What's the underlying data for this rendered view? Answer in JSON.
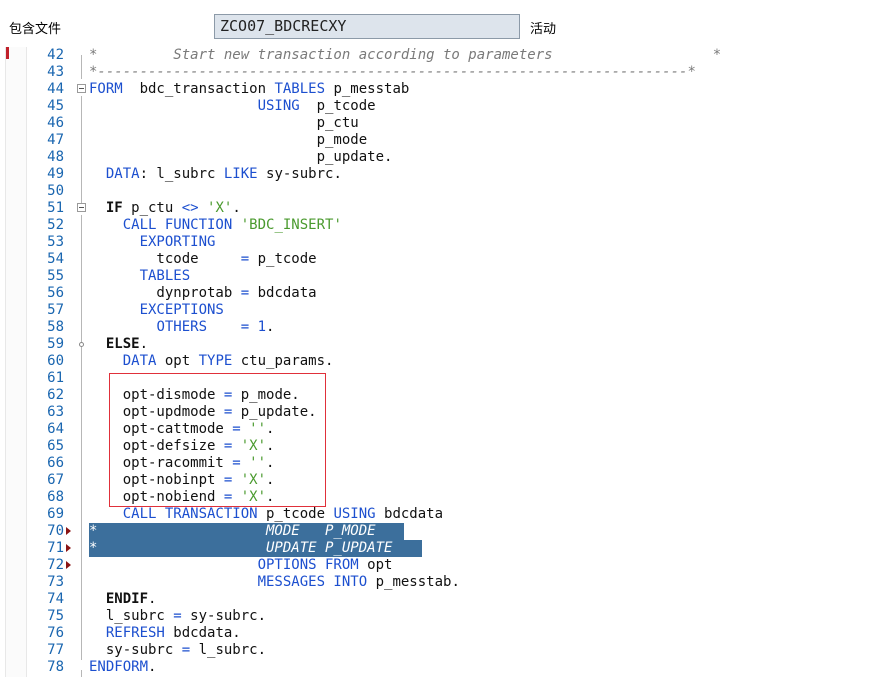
{
  "header": {
    "include_label": "包含文件",
    "program_name": "ZCO07_BDCRECXY",
    "status": "活动"
  },
  "editor": {
    "lines": [
      {
        "n": "42",
        "t": [
          [
            "cmt",
            "*         Start new transaction according to parameters                   *"
          ]
        ]
      },
      {
        "n": "43",
        "t": [
          [
            "cmt",
            "*----------------------------------------------------------------------*"
          ]
        ]
      },
      {
        "n": "44",
        "t": [
          [
            "kw",
            "FORM"
          ],
          [
            "",
            "  bdc_transaction "
          ],
          [
            "kw",
            "TABLES"
          ],
          [
            "",
            " p_messtab"
          ]
        ]
      },
      {
        "n": "45",
        "t": [
          [
            "",
            "                    "
          ],
          [
            "kw",
            "USING"
          ],
          [
            "",
            "  p_tcode"
          ]
        ]
      },
      {
        "n": "46",
        "t": [
          [
            "",
            "                           p_ctu"
          ]
        ]
      },
      {
        "n": "47",
        "t": [
          [
            "",
            "                           p_mode"
          ]
        ]
      },
      {
        "n": "48",
        "t": [
          [
            "",
            "                           p_update."
          ]
        ]
      },
      {
        "n": "49",
        "t": [
          [
            "",
            "  "
          ],
          [
            "kw",
            "DATA"
          ],
          [
            "",
            ": l_subrc "
          ],
          [
            "kw",
            "LIKE"
          ],
          [
            "",
            " sy-subrc."
          ]
        ]
      },
      {
        "n": "50",
        "t": []
      },
      {
        "n": "51",
        "t": [
          [
            "",
            "  "
          ],
          [
            "b",
            "IF"
          ],
          [
            "",
            " p_ctu "
          ],
          [
            "kw",
            "<>"
          ],
          [
            "",
            " "
          ],
          [
            "str",
            "'X'"
          ],
          [
            "",
            "."
          ]
        ]
      },
      {
        "n": "52",
        "t": [
          [
            "",
            "    "
          ],
          [
            "kw",
            "CALL FUNCTION"
          ],
          [
            "",
            " "
          ],
          [
            "str",
            "'BDC_INSERT'"
          ]
        ]
      },
      {
        "n": "53",
        "t": [
          [
            "",
            "      "
          ],
          [
            "kw",
            "EXPORTING"
          ]
        ]
      },
      {
        "n": "54",
        "t": [
          [
            "",
            "        tcode     "
          ],
          [
            "kw",
            "="
          ],
          [
            "",
            " p_tcode"
          ]
        ]
      },
      {
        "n": "55",
        "t": [
          [
            "",
            "      "
          ],
          [
            "kw",
            "TABLES"
          ]
        ]
      },
      {
        "n": "56",
        "t": [
          [
            "",
            "        dynprotab "
          ],
          [
            "kw",
            "="
          ],
          [
            "",
            " bdcdata"
          ]
        ]
      },
      {
        "n": "57",
        "t": [
          [
            "",
            "      "
          ],
          [
            "kw",
            "EXCEPTIONS"
          ]
        ]
      },
      {
        "n": "58",
        "t": [
          [
            "",
            "        "
          ],
          [
            "kw",
            "OTHERS"
          ],
          [
            "",
            "    "
          ],
          [
            "kw",
            "="
          ],
          [
            "",
            " "
          ],
          [
            "num",
            "1"
          ],
          [
            "",
            "."
          ]
        ]
      },
      {
        "n": "59",
        "t": [
          [
            "",
            "  "
          ],
          [
            "b",
            "ELSE"
          ],
          [
            "",
            "."
          ]
        ]
      },
      {
        "n": "60",
        "t": [
          [
            "",
            "    "
          ],
          [
            "kw",
            "DATA"
          ],
          [
            "",
            " opt "
          ],
          [
            "kw",
            "TYPE"
          ],
          [
            "",
            " ctu_params."
          ]
        ]
      },
      {
        "n": "61",
        "t": []
      },
      {
        "n": "62",
        "t": [
          [
            "",
            "    opt-dismode "
          ],
          [
            "kw",
            "="
          ],
          [
            "",
            " p_mode."
          ]
        ]
      },
      {
        "n": "63",
        "t": [
          [
            "",
            "    opt-updmode "
          ],
          [
            "kw",
            "="
          ],
          [
            "",
            " p_update."
          ]
        ]
      },
      {
        "n": "64",
        "t": [
          [
            "",
            "    opt-cattmode "
          ],
          [
            "kw",
            "="
          ],
          [
            "",
            " "
          ],
          [
            "str",
            "''"
          ],
          [
            "",
            "."
          ]
        ]
      },
      {
        "n": "65",
        "t": [
          [
            "",
            "    opt-defsize "
          ],
          [
            "kw",
            "="
          ],
          [
            "",
            " "
          ],
          [
            "str",
            "'X'"
          ],
          [
            "",
            "."
          ]
        ]
      },
      {
        "n": "66",
        "t": [
          [
            "",
            "    opt-racommit "
          ],
          [
            "kw",
            "="
          ],
          [
            "",
            " "
          ],
          [
            "str",
            "''"
          ],
          [
            "",
            "."
          ]
        ]
      },
      {
        "n": "67",
        "t": [
          [
            "",
            "    opt-nobinpt "
          ],
          [
            "kw",
            "="
          ],
          [
            "",
            " "
          ],
          [
            "str",
            "'X'"
          ],
          [
            "",
            "."
          ]
        ]
      },
      {
        "n": "68",
        "t": [
          [
            "",
            "    opt-nobiend "
          ],
          [
            "kw",
            "="
          ],
          [
            "",
            " "
          ],
          [
            "str",
            "'X'"
          ],
          [
            "",
            "."
          ]
        ]
      },
      {
        "n": "69",
        "t": [
          [
            "",
            "    "
          ],
          [
            "kw",
            "CALL TRANSACTION"
          ],
          [
            "",
            " p_tcode "
          ],
          [
            "kw",
            "USING"
          ],
          [
            "",
            " bdcdata"
          ]
        ]
      },
      {
        "n": "70",
        "hl": "*                    MODE   P_MODE"
      },
      {
        "n": "71",
        "hl": "*                    UPDATE P_UPDATE"
      },
      {
        "n": "72",
        "t": [
          [
            "",
            "                    "
          ],
          [
            "kw",
            "OPTIONS FROM"
          ],
          [
            "",
            " opt"
          ]
        ]
      },
      {
        "n": "73",
        "t": [
          [
            "",
            "                    "
          ],
          [
            "kw",
            "MESSAGES INTO"
          ],
          [
            "",
            " p_messtab."
          ]
        ]
      },
      {
        "n": "74",
        "t": [
          [
            "",
            "  "
          ],
          [
            "b",
            "ENDIF"
          ],
          [
            "",
            "."
          ]
        ]
      },
      {
        "n": "75",
        "t": [
          [
            "",
            "  l_subrc "
          ],
          [
            "kw",
            "="
          ],
          [
            "",
            " sy-subrc."
          ]
        ]
      },
      {
        "n": "76",
        "t": [
          [
            "",
            "  "
          ],
          [
            "kw",
            "REFRESH"
          ],
          [
            "",
            " bdcdata."
          ]
        ]
      },
      {
        "n": "77",
        "t": [
          [
            "",
            "  sy-subrc "
          ],
          [
            "kw",
            "="
          ],
          [
            "",
            " l_subrc."
          ]
        ]
      },
      {
        "n": "78",
        "t": [
          [
            "kw",
            "ENDFORM"
          ],
          [
            "",
            "."
          ]
        ]
      }
    ]
  },
  "colors": {
    "keyword": "#1c4fcf",
    "string": "#4a9a2e",
    "comment": "#7a7a7a",
    "line_number": "#1a66b0",
    "selection": "#3c6f9c",
    "annotation_box": "#e0303a"
  }
}
